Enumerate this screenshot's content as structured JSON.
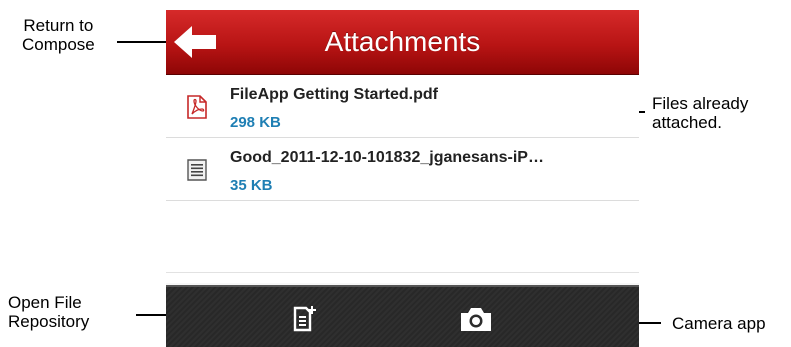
{
  "header": {
    "title": "Attachments",
    "back_icon": "back-arrow-icon"
  },
  "attachments": [
    {
      "icon": "pdf-file-icon",
      "name": "FileApp Getting Started.pdf",
      "size": "298 KB"
    },
    {
      "icon": "document-file-icon",
      "name": "Good_2011-12-10-101832_jganesans-iP…",
      "size": "35 KB"
    }
  ],
  "toolbar": {
    "file_repository_icon": "add-file-icon",
    "camera_icon": "camera-icon"
  },
  "callouts": {
    "return_to_compose_line1": "Return to",
    "return_to_compose_line2": "Compose",
    "files_attached_line1": "Files already",
    "files_attached_line2": "attached.",
    "open_repository_line1": "Open File",
    "open_repository_line2": "Repository",
    "camera_app": "Camera app"
  },
  "colors": {
    "titlebar_red": "#b81414",
    "file_size_blue": "#1f7fb4",
    "toolbar_dark": "#2c2c2c"
  }
}
